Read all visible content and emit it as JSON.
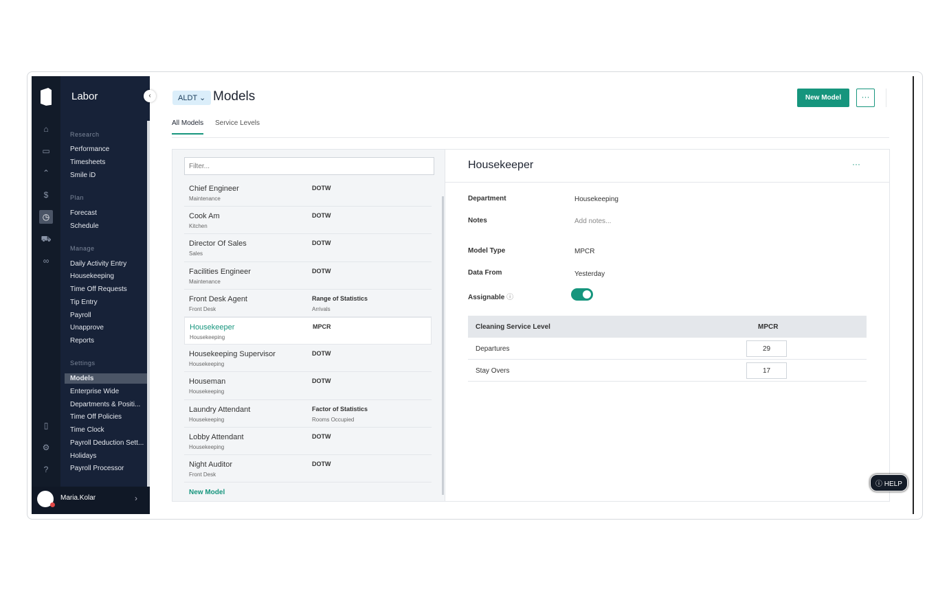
{
  "nav": {
    "title": "Labor",
    "sections": [
      {
        "label": "Research",
        "items": [
          "Performance",
          "Timesheets",
          "Smile iD"
        ]
      },
      {
        "label": "Plan",
        "items": [
          "Forecast",
          "Schedule"
        ]
      },
      {
        "label": "Manage",
        "items": [
          "Daily Activity Entry",
          "Housekeeping",
          "Time Off Requests",
          "Tip Entry",
          "Payroll",
          "Unapprove",
          "Reports"
        ]
      },
      {
        "label": "Settings",
        "items": [
          "Models",
          "Enterprise Wide",
          "Departments & Positi...",
          "Time Off Policies",
          "Time Clock",
          "Payroll Deduction Sett...",
          "Holidays",
          "Payroll Processor"
        ]
      }
    ],
    "user": "Maria.Kolar"
  },
  "header": {
    "property": "ALDT",
    "title": "Models",
    "new_model": "New Model",
    "more": "···"
  },
  "tabs": [
    "All Models",
    "Service Levels"
  ],
  "list": {
    "filter_placeholder": "Filter...",
    "new_model": "New Model",
    "rows": [
      {
        "name": "Chief Engineer",
        "dept": "Maintenance",
        "type": "DOTW",
        "sub": ""
      },
      {
        "name": "Cook Am",
        "dept": "Kitchen",
        "type": "DOTW",
        "sub": ""
      },
      {
        "name": "Director Of Sales",
        "dept": "Sales",
        "type": "DOTW",
        "sub": ""
      },
      {
        "name": "Facilities Engineer",
        "dept": "Maintenance",
        "type": "DOTW",
        "sub": ""
      },
      {
        "name": "Front Desk Agent",
        "dept": "Front Desk",
        "type": "Range of Statistics",
        "sub": "Arrivals"
      },
      {
        "name": "Housekeeper",
        "dept": "Housekeeping",
        "type": "MPCR",
        "sub": ""
      },
      {
        "name": "Housekeeping Supervisor",
        "dept": "Housekeeping",
        "type": "DOTW",
        "sub": ""
      },
      {
        "name": "Houseman",
        "dept": "Housekeeping",
        "type": "DOTW",
        "sub": ""
      },
      {
        "name": "Laundry Attendant",
        "dept": "Housekeeping",
        "type": "Factor of Statistics",
        "sub": "Rooms Occupied"
      },
      {
        "name": "Lobby Attendant",
        "dept": "Housekeeping",
        "type": "DOTW",
        "sub": ""
      },
      {
        "name": "Night Auditor",
        "dept": "Front Desk",
        "type": "DOTW",
        "sub": ""
      }
    ]
  },
  "detail": {
    "title": "Housekeeper",
    "more": "···",
    "department_label": "Department",
    "department": "Housekeeping",
    "notes_label": "Notes",
    "notes_placeholder": "Add notes...",
    "model_type_label": "Model Type",
    "model_type": "MPCR",
    "data_from_label": "Data From",
    "data_from": "Yesterday",
    "assignable_label": "Assignable",
    "assignable": true,
    "table": {
      "headers": [
        "Cleaning Service Level",
        "MPCR"
      ],
      "rows": [
        {
          "label": "Departures",
          "value": "29"
        },
        {
          "label": "Stay Overs",
          "value": "17"
        }
      ]
    }
  },
  "help": "HELP"
}
